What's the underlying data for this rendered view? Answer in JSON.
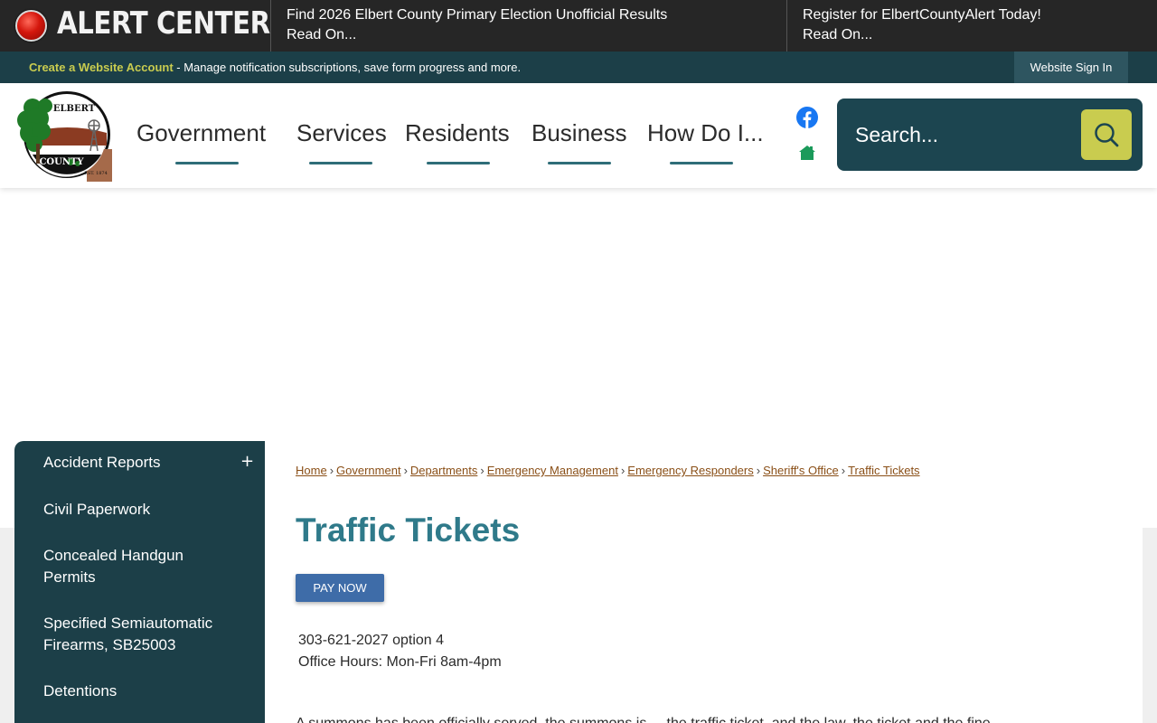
{
  "alert_bar": {
    "title": "ALERT CENTER",
    "items": [
      {
        "headline": "Find 2026 Elbert County Primary Election Unofficial Results",
        "link": "Read On..."
      },
      {
        "headline": "Register for ElbertCountyAlert Today!",
        "link": "Read On..."
      }
    ]
  },
  "account_bar": {
    "create_link": "Create a Website Account",
    "description": " - Manage notification subscriptions, save form progress and more.",
    "sign_in": "Website Sign In"
  },
  "logo": {
    "top_text": "ELBERT",
    "bottom_text": "COUNTY",
    "est": "EST. 1874"
  },
  "nav": {
    "items": [
      "Government",
      "Services",
      "Residents",
      "Business",
      "How Do I..."
    ]
  },
  "social": {
    "facebook": "facebook-icon",
    "home": "home-icon"
  },
  "search": {
    "placeholder": "Search..."
  },
  "sidebar": {
    "items": [
      {
        "label": "Accident Reports",
        "expand": "+"
      },
      {
        "label": "Civil Paperwork"
      },
      {
        "label": "Concealed Handgun Permits"
      },
      {
        "label": "Specified Semiautomatic Firearms, SB25003"
      },
      {
        "label": "Detentions"
      }
    ]
  },
  "breadcrumb": [
    "Home",
    "Government",
    "Departments",
    "Emergency Management",
    "Emergency Responders",
    "Sheriff's Office",
    "Traffic Tickets"
  ],
  "page": {
    "title": "Traffic Tickets",
    "pay_button": "PAY NOW",
    "phone": "303-621-2027 option 4",
    "hours": "Office Hours: Mon-Fri 8am-4pm",
    "body_start": "A summons has been officially served, the summons is ... the traffic ticket, and the law, the ticket and the fine."
  },
  "colors": {
    "dark_teal": "#1c3f48",
    "accent_yellow": "#c9cc4f",
    "title_teal": "#2f7a8a",
    "link_brown": "#8a4f17",
    "pay_blue": "#3e6ca8"
  }
}
